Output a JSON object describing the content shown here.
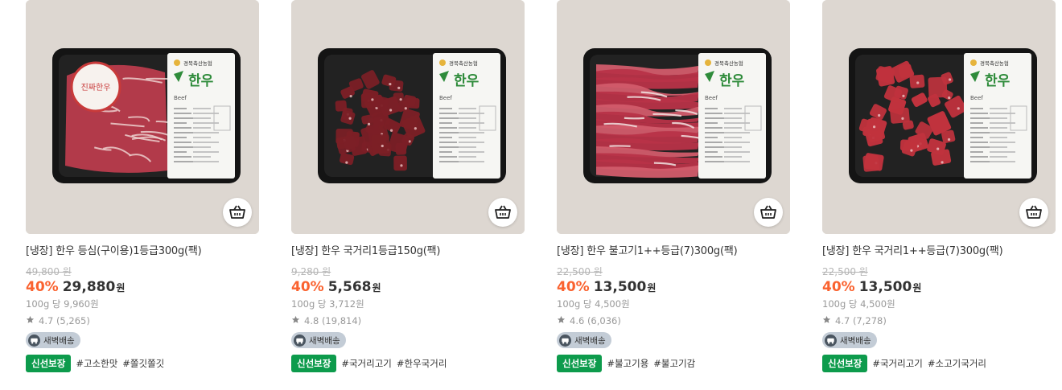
{
  "products": [
    {
      "title": "[냉장] 한우 등심(구이용)1등급300g(팩)",
      "original_price": "49,800 원",
      "discount": "40%",
      "price": "29,880",
      "currency": "원",
      "unit_price": "100g 당 9,960원",
      "rating": "4.7 (5,265)",
      "delivery_badge": "새벽배송",
      "fresh_badge": "신선보장",
      "tags": [
        "#고소한맛",
        "#쫄깃쫄깃"
      ],
      "package_brand": "경북축산농협",
      "package_name": "한우",
      "package_sub": "Beef",
      "cut_style": "sirloin",
      "sticker_text": "진짜한우"
    },
    {
      "title": "[냉장] 한우 국거리1등급150g(팩)",
      "original_price": "9,280 원",
      "discount": "40%",
      "price": "5,568",
      "currency": "원",
      "unit_price": "100g 당 3,712원",
      "rating": "4.8 (19,814)",
      "delivery_badge": "새벽배송",
      "fresh_badge": "신선보장",
      "tags": [
        "#국거리고기",
        "#한우국거리"
      ],
      "package_brand": "경북축산농협",
      "package_name": "한우",
      "package_sub": "Beef",
      "cut_style": "soup"
    },
    {
      "title": "[냉장] 한우 불고기1++등급(7)300g(팩)",
      "original_price": "22,500 원",
      "discount": "40%",
      "price": "13,500",
      "currency": "원",
      "unit_price": "100g 당 4,500원",
      "rating": "4.6 (6,036)",
      "delivery_badge": "새벽배송",
      "fresh_badge": "신선보장",
      "tags": [
        "#불고기용",
        "#불고기감"
      ],
      "package_brand": "경북축산농협",
      "package_name": "한우",
      "package_sub": "Beef",
      "cut_style": "bulgogi"
    },
    {
      "title": "[냉장] 한우 국거리1++등급(7)300g(팩)",
      "original_price": "22,500 원",
      "discount": "40%",
      "price": "13,500",
      "currency": "원",
      "unit_price": "100g 당 4,500원",
      "rating": "4.7 (7,278)",
      "delivery_badge": "새벽배송",
      "fresh_badge": "신선보장",
      "tags": [
        "#국거리고기",
        "#소고기국거리"
      ],
      "package_brand": "경북축산농협",
      "package_name": "한우",
      "package_sub": "Beef",
      "cut_style": "cubes"
    }
  ],
  "colors": {
    "discount": "#fa622f",
    "fresh_badge": "#0d9b4c",
    "delivery_badge_bg": "#c3ccd6",
    "brand_green": "#2e8b3a"
  },
  "icons": {
    "cart": "cart-icon",
    "star": "star-icon",
    "delivery": "truck-icon"
  }
}
